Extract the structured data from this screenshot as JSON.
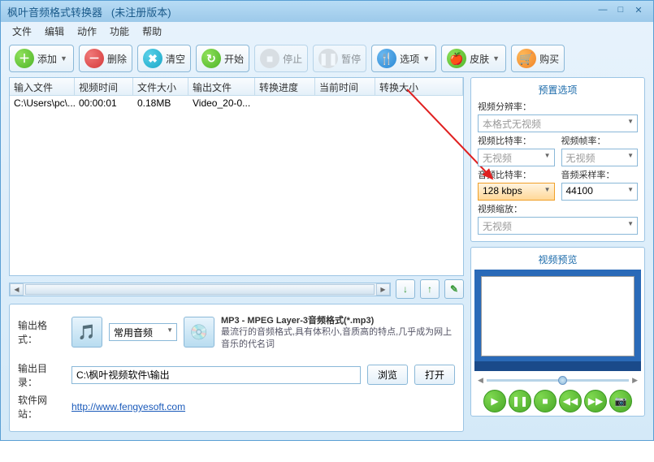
{
  "title": "枫叶音频格式转换器",
  "title_suffix": "(未注册版本)",
  "menu": {
    "file": "文件",
    "edit": "编辑",
    "action": "动作",
    "function": "功能",
    "help": "帮助"
  },
  "toolbar": {
    "add": "添加",
    "delete": "删除",
    "clear": "清空",
    "start": "开始",
    "stop": "停止",
    "pause": "暂停",
    "options": "选项",
    "skin": "皮肤",
    "buy": "购买"
  },
  "table": {
    "headers": {
      "input": "输入文件",
      "vtime": "视频时间",
      "size": "文件大小",
      "output": "输出文件",
      "progress": "转换进度",
      "curtime": "当前时间",
      "convsize": "转换大小"
    },
    "rows": [
      {
        "input": "C:\\Users\\pc\\...",
        "vtime": "00:00:01",
        "size": "0.18MB",
        "output": "Video_20-0...",
        "progress": "",
        "curtime": "",
        "convsize": ""
      }
    ]
  },
  "output": {
    "format_label": "输出格式：",
    "category": "常用音频",
    "format_name": "MP3 - MPEG Layer-3音频格式(*.mp3)",
    "format_desc": "最流行的音频格式,具有体积小,音质高的特点,几乎成为网上音乐的代名词",
    "dir_label": "输出目录：",
    "dir": "C:\\枫叶视频软件\\输出",
    "browse": "浏览",
    "open": "打开",
    "site_label": "软件网站：",
    "site": "http://www.fengyesoft.com"
  },
  "preset": {
    "title": "预置选项",
    "vres_label": "视频分辨率：",
    "vres": "本格式无视频",
    "vbit_label": "视频比特率：",
    "vbit": "无视频",
    "vfps_label": "视频帧率：",
    "vfps": "无视频",
    "abit_label": "音频比特率：",
    "abit": "128 kbps",
    "asample_label": "音频采样率：",
    "asample": "44100",
    "vzoom_label": "视频缩放：",
    "vzoom": "无视频"
  },
  "preview": {
    "title": "视频预览"
  }
}
